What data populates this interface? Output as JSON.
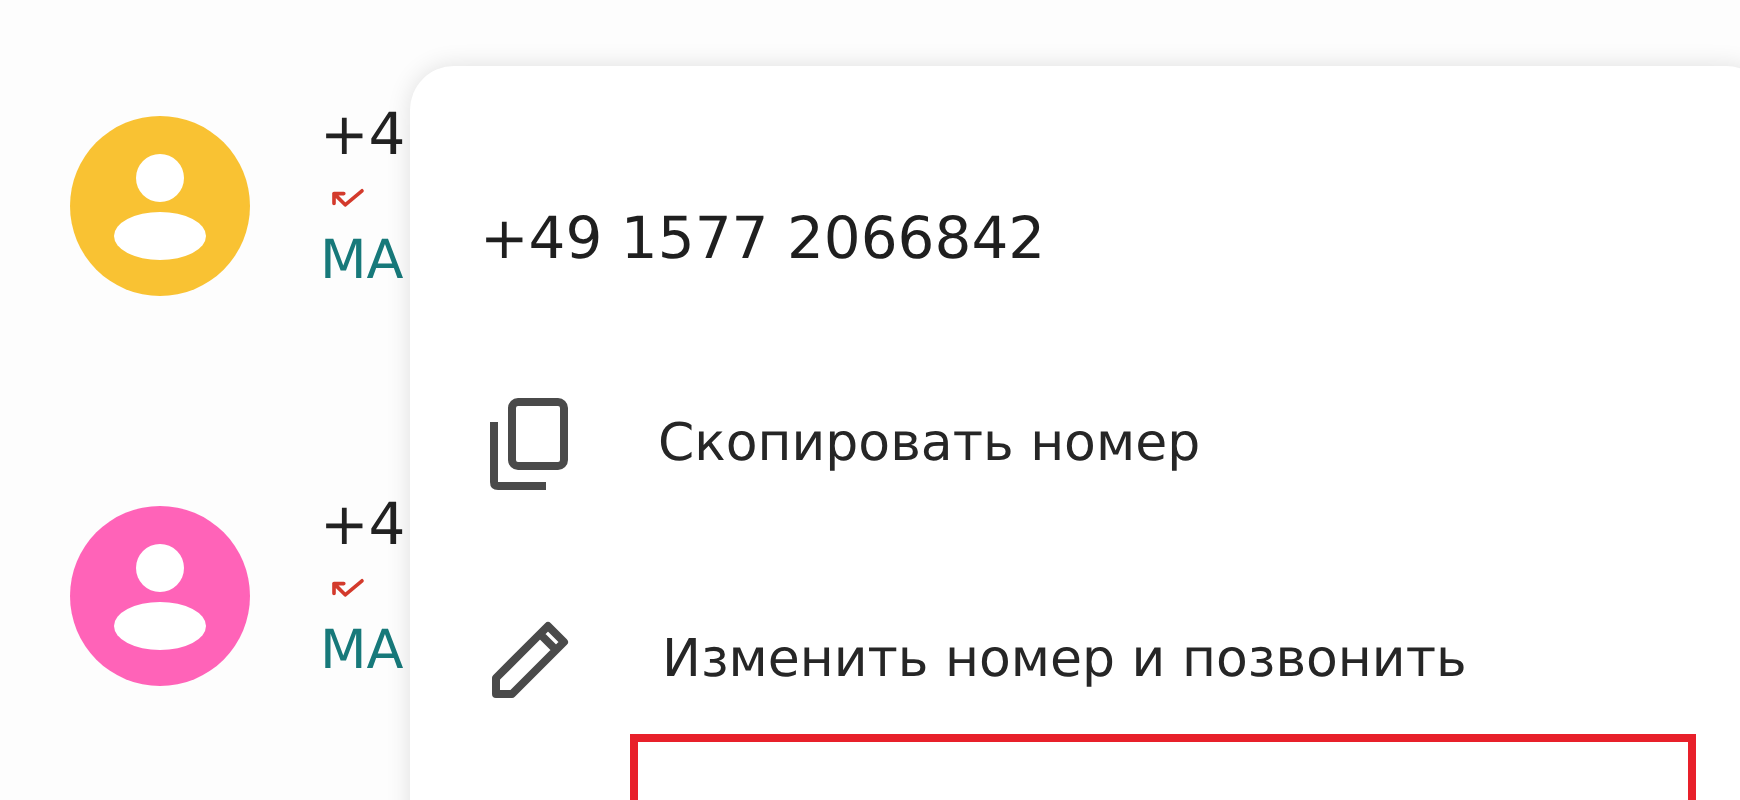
{
  "call_log": [
    {
      "color": "#f9c233",
      "number": "+4",
      "kind": "missed",
      "label": "MA"
    },
    {
      "color": "#ff63b8",
      "number": "+4",
      "kind": "missed",
      "label": "MA"
    }
  ],
  "menu": {
    "title": "+49 1577 2066842",
    "items": [
      {
        "kind": "copy",
        "label": "Скопировать номер"
      },
      {
        "kind": "edit",
        "label": "Изменить номер и позвонить"
      }
    ],
    "highlighted_item": true
  }
}
